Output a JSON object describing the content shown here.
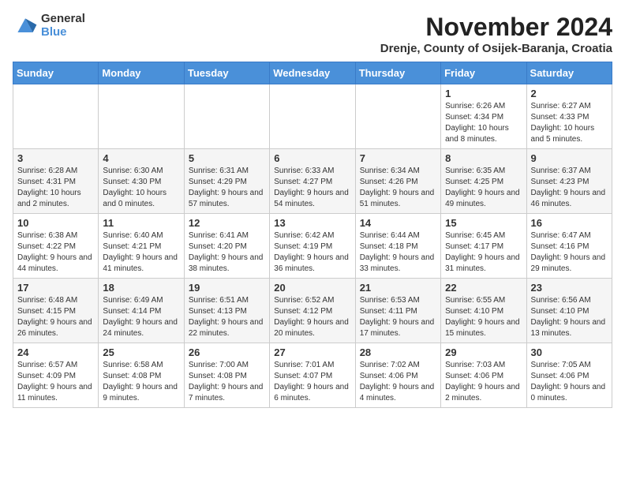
{
  "header": {
    "logo_general": "General",
    "logo_blue": "Blue",
    "month_title": "November 2024",
    "location": "Drenje, County of Osijek-Baranja, Croatia"
  },
  "days_of_week": [
    "Sunday",
    "Monday",
    "Tuesday",
    "Wednesday",
    "Thursday",
    "Friday",
    "Saturday"
  ],
  "weeks": [
    [
      {
        "day": "",
        "info": ""
      },
      {
        "day": "",
        "info": ""
      },
      {
        "day": "",
        "info": ""
      },
      {
        "day": "",
        "info": ""
      },
      {
        "day": "",
        "info": ""
      },
      {
        "day": "1",
        "info": "Sunrise: 6:26 AM\nSunset: 4:34 PM\nDaylight: 10 hours and 8 minutes."
      },
      {
        "day": "2",
        "info": "Sunrise: 6:27 AM\nSunset: 4:33 PM\nDaylight: 10 hours and 5 minutes."
      }
    ],
    [
      {
        "day": "3",
        "info": "Sunrise: 6:28 AM\nSunset: 4:31 PM\nDaylight: 10 hours and 2 minutes."
      },
      {
        "day": "4",
        "info": "Sunrise: 6:30 AM\nSunset: 4:30 PM\nDaylight: 10 hours and 0 minutes."
      },
      {
        "day": "5",
        "info": "Sunrise: 6:31 AM\nSunset: 4:29 PM\nDaylight: 9 hours and 57 minutes."
      },
      {
        "day": "6",
        "info": "Sunrise: 6:33 AM\nSunset: 4:27 PM\nDaylight: 9 hours and 54 minutes."
      },
      {
        "day": "7",
        "info": "Sunrise: 6:34 AM\nSunset: 4:26 PM\nDaylight: 9 hours and 51 minutes."
      },
      {
        "day": "8",
        "info": "Sunrise: 6:35 AM\nSunset: 4:25 PM\nDaylight: 9 hours and 49 minutes."
      },
      {
        "day": "9",
        "info": "Sunrise: 6:37 AM\nSunset: 4:23 PM\nDaylight: 9 hours and 46 minutes."
      }
    ],
    [
      {
        "day": "10",
        "info": "Sunrise: 6:38 AM\nSunset: 4:22 PM\nDaylight: 9 hours and 44 minutes."
      },
      {
        "day": "11",
        "info": "Sunrise: 6:40 AM\nSunset: 4:21 PM\nDaylight: 9 hours and 41 minutes."
      },
      {
        "day": "12",
        "info": "Sunrise: 6:41 AM\nSunset: 4:20 PM\nDaylight: 9 hours and 38 minutes."
      },
      {
        "day": "13",
        "info": "Sunrise: 6:42 AM\nSunset: 4:19 PM\nDaylight: 9 hours and 36 minutes."
      },
      {
        "day": "14",
        "info": "Sunrise: 6:44 AM\nSunset: 4:18 PM\nDaylight: 9 hours and 33 minutes."
      },
      {
        "day": "15",
        "info": "Sunrise: 6:45 AM\nSunset: 4:17 PM\nDaylight: 9 hours and 31 minutes."
      },
      {
        "day": "16",
        "info": "Sunrise: 6:47 AM\nSunset: 4:16 PM\nDaylight: 9 hours and 29 minutes."
      }
    ],
    [
      {
        "day": "17",
        "info": "Sunrise: 6:48 AM\nSunset: 4:15 PM\nDaylight: 9 hours and 26 minutes."
      },
      {
        "day": "18",
        "info": "Sunrise: 6:49 AM\nSunset: 4:14 PM\nDaylight: 9 hours and 24 minutes."
      },
      {
        "day": "19",
        "info": "Sunrise: 6:51 AM\nSunset: 4:13 PM\nDaylight: 9 hours and 22 minutes."
      },
      {
        "day": "20",
        "info": "Sunrise: 6:52 AM\nSunset: 4:12 PM\nDaylight: 9 hours and 20 minutes."
      },
      {
        "day": "21",
        "info": "Sunrise: 6:53 AM\nSunset: 4:11 PM\nDaylight: 9 hours and 17 minutes."
      },
      {
        "day": "22",
        "info": "Sunrise: 6:55 AM\nSunset: 4:10 PM\nDaylight: 9 hours and 15 minutes."
      },
      {
        "day": "23",
        "info": "Sunrise: 6:56 AM\nSunset: 4:10 PM\nDaylight: 9 hours and 13 minutes."
      }
    ],
    [
      {
        "day": "24",
        "info": "Sunrise: 6:57 AM\nSunset: 4:09 PM\nDaylight: 9 hours and 11 minutes."
      },
      {
        "day": "25",
        "info": "Sunrise: 6:58 AM\nSunset: 4:08 PM\nDaylight: 9 hours and 9 minutes."
      },
      {
        "day": "26",
        "info": "Sunrise: 7:00 AM\nSunset: 4:08 PM\nDaylight: 9 hours and 7 minutes."
      },
      {
        "day": "27",
        "info": "Sunrise: 7:01 AM\nSunset: 4:07 PM\nDaylight: 9 hours and 6 minutes."
      },
      {
        "day": "28",
        "info": "Sunrise: 7:02 AM\nSunset: 4:06 PM\nDaylight: 9 hours and 4 minutes."
      },
      {
        "day": "29",
        "info": "Sunrise: 7:03 AM\nSunset: 4:06 PM\nDaylight: 9 hours and 2 minutes."
      },
      {
        "day": "30",
        "info": "Sunrise: 7:05 AM\nSunset: 4:06 PM\nDaylight: 9 hours and 0 minutes."
      }
    ]
  ]
}
